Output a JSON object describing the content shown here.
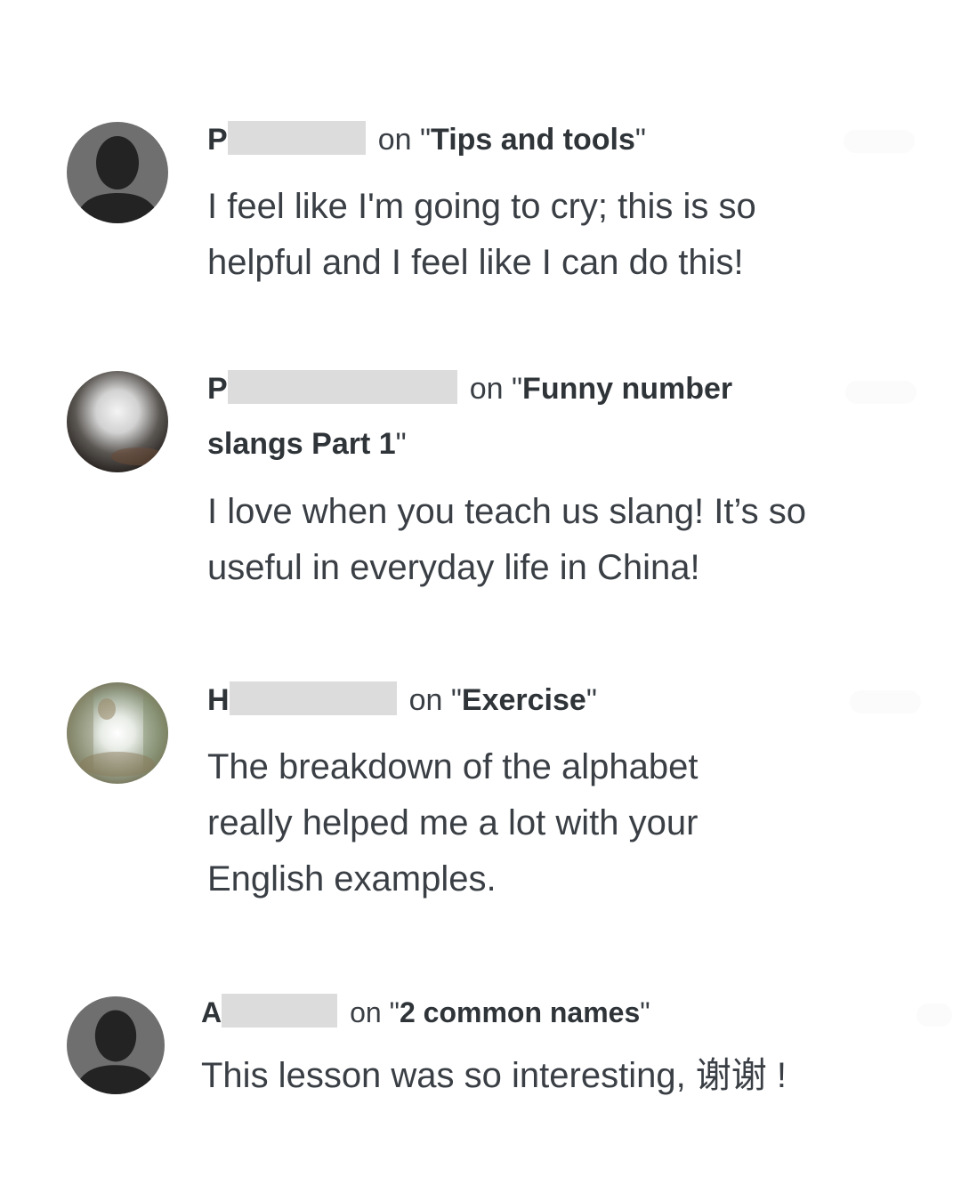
{
  "comments": [
    {
      "initial": "P",
      "on_label": "on",
      "lesson_open": "\"",
      "lesson_title": "Tips and tools",
      "lesson_close": "\"",
      "avatar": "default-person-icon",
      "text": "I feel like I'm going to cry; this is so helpful and I feel like I can do this!"
    },
    {
      "initial": "P",
      "on_label": "on",
      "lesson_open": "\"",
      "lesson_title_line1": "Funny number",
      "lesson_title_line2": "slangs Part 1",
      "lesson_close": "\"",
      "avatar": "photo-avatar-blurred",
      "text": "I love when you teach us slang! It’s so useful in everyday life in China!"
    },
    {
      "initial": "H",
      "on_label": "on",
      "lesson_open": "\"",
      "lesson_title": "Exercise",
      "lesson_close": "\"",
      "avatar": "photo-avatar-outdoor",
      "text": "The breakdown of the alphabet really helped me a lot with your English examples."
    },
    {
      "initial": "A",
      "on_label": "on",
      "lesson_open": "\"",
      "lesson_title": "2 common names",
      "lesson_close": "\"",
      "avatar": "default-person-icon",
      "text": "This lesson was so interesting, 谢谢 !"
    }
  ],
  "colors": {
    "text": "#3a3f45",
    "redaction": "#dcdcdc",
    "avatar_bg": "#707070",
    "avatar_silhouette": "#222222"
  }
}
